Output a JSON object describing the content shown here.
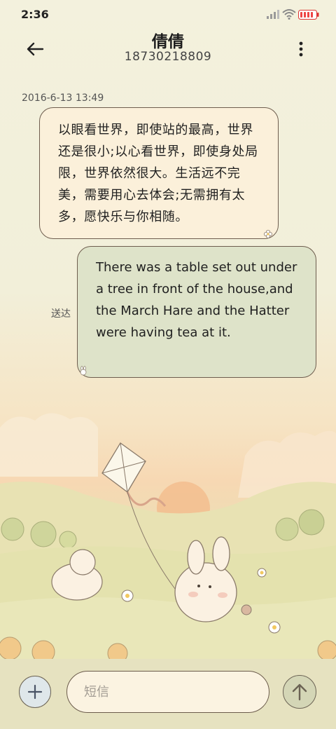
{
  "status_bar": {
    "time": "2:36",
    "icons": [
      "signal-icon",
      "wifi-icon",
      "battery-icon"
    ]
  },
  "header": {
    "back_icon": "arrow-left-icon",
    "contact_name": "倩倩",
    "contact_number": "18730218809",
    "more_icon": "more-vertical-icon"
  },
  "conversation": {
    "timestamp": "2016-6-13 13:49",
    "messages": [
      {
        "direction": "received",
        "text": "以眼看世界，即使站的最高，世界还是很小;以心看世界，即使身处局限，世界依然很大。生活远不完美，需要用心去体会;无需拥有太多，愿快乐与你相随。"
      },
      {
        "direction": "sent",
        "text": "There was a table set out under a tree in front of the house,and the March Hare and the Hatter were having tea at it.",
        "status": "送达"
      }
    ]
  },
  "composer": {
    "add_icon": "plus-icon",
    "placeholder": "短信",
    "value": "",
    "send_icon": "arrow-up-icon"
  },
  "colors": {
    "received_bubble": "#fbf0da",
    "sent_bubble": "#dee3c9",
    "bubble_border": "#6e5d4e",
    "sky_sunset": "#f7d8b3",
    "grass": "#e3e0ad"
  }
}
